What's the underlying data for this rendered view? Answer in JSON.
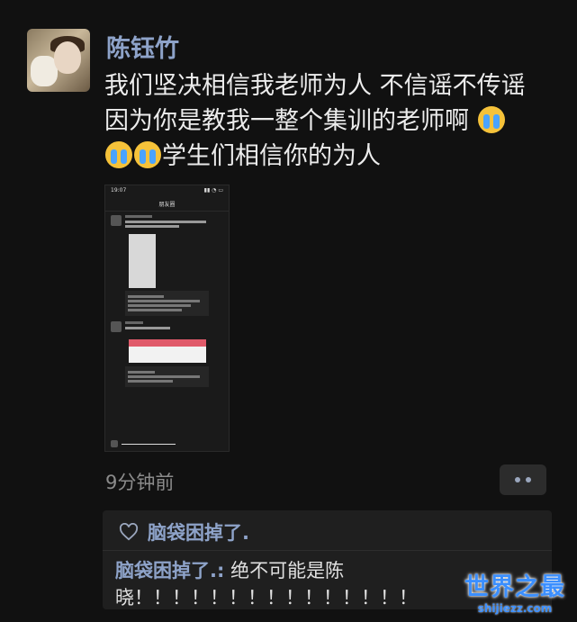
{
  "post": {
    "author": "陈钰竹",
    "text_line1": "我们坚决相信我老师为人 不信谣不传谣",
    "text_line2_a": " 因为你是教我一整个集训的老师啊 ",
    "text_line3": "学生们相信你的为人",
    "time": "9分钟前",
    "emoji_icon": "crying-face"
  },
  "screenshot_thumb": {
    "status_time": "19:07",
    "nav_title": "朋友圈"
  },
  "comments": {
    "likes": "脑袋困掉了.",
    "comment_author": "脑袋困掉了.:",
    "comment_text": " 绝不可能是陈晓！！！！！！！！！！！！！！！"
  },
  "watermark": {
    "title": "世界之最",
    "url": "shijiezz.com"
  },
  "colors": {
    "background": "#111111",
    "name_blue": "#8ea3c9",
    "watermark_blue": "#3b8fff"
  }
}
